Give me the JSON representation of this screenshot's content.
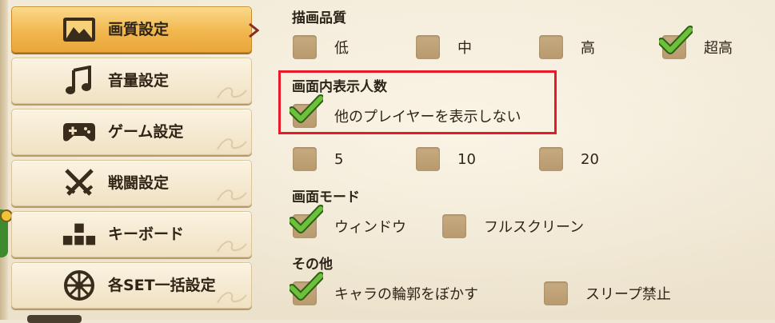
{
  "sidebar": {
    "items": [
      {
        "label": "画質設定",
        "icon": "landscape-picture-icon",
        "active": true
      },
      {
        "label": "音量設定",
        "icon": "music-note-icon",
        "active": false
      },
      {
        "label": "ゲーム設定",
        "icon": "gamepad-icon",
        "active": false
      },
      {
        "label": "戦闘設定",
        "icon": "crossed-swords-icon",
        "active": false
      },
      {
        "label": "キーボード",
        "icon": "keyboard-keys-icon",
        "active": false
      },
      {
        "label": "各SET一括設定",
        "icon": "compass-wheel-icon",
        "active": false
      }
    ]
  },
  "settings": {
    "quality": {
      "title": "描画品質",
      "options": [
        {
          "label": "低",
          "checked": false
        },
        {
          "label": "中",
          "checked": false
        },
        {
          "label": "高",
          "checked": false
        },
        {
          "label": "超高",
          "checked": true
        }
      ]
    },
    "display_count": {
      "title": "画面内表示人数",
      "hide_players": {
        "label": "他のプレイヤーを表示しない",
        "checked": true
      },
      "options": [
        {
          "label": "5",
          "checked": false
        },
        {
          "label": "10",
          "checked": false
        },
        {
          "label": "20",
          "checked": false
        }
      ]
    },
    "screen_mode": {
      "title": "画面モード",
      "options": [
        {
          "label": "ウィンドウ",
          "checked": true
        },
        {
          "label": "フルスクリーン",
          "checked": false
        }
      ]
    },
    "other": {
      "title": "その他",
      "options": [
        {
          "label": "キャラの輪郭をぼかす",
          "checked": true
        },
        {
          "label": "スリープ禁止",
          "checked": false
        }
      ]
    }
  },
  "colors": {
    "highlight_border": "#e8192a",
    "active_tab": "#f1b74e",
    "check_green": "#5aa02c"
  }
}
